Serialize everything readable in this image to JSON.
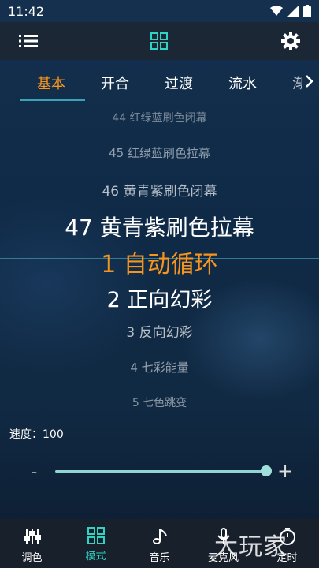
{
  "status": {
    "time": "11:42"
  },
  "tabs": [
    {
      "label": "基本",
      "active": true
    },
    {
      "label": "开合",
      "active": false
    },
    {
      "label": "过渡",
      "active": false
    },
    {
      "label": "流水",
      "active": false
    },
    {
      "label": "渐",
      "active": false
    }
  ],
  "wheel": [
    {
      "label": "44 红绿蓝刷色闭幕"
    },
    {
      "label": "45 红绿蓝刷色拉幕"
    },
    {
      "label": "46 黄青紫刷色闭幕"
    },
    {
      "label": "47 黄青紫刷色拉幕"
    },
    {
      "label": "1 自动循环",
      "selected": true
    },
    {
      "label": "2 正向幻彩"
    },
    {
      "label": "3 反向幻彩"
    },
    {
      "label": "4 七彩能量"
    },
    {
      "label": "5 七色跳变"
    }
  ],
  "speed": {
    "label": "速度：100",
    "value": 100,
    "minus": "-",
    "plus": "+"
  },
  "bottom_nav": [
    {
      "label": "调色",
      "icon": "sliders-icon"
    },
    {
      "label": "模式",
      "icon": "grid-icon",
      "active": true
    },
    {
      "label": "音乐",
      "icon": "music-note-icon"
    },
    {
      "label": "麦克风",
      "icon": "microphone-icon"
    },
    {
      "label": "定时",
      "icon": "timer-icon"
    }
  ],
  "watermark": "大玩家",
  "colors": {
    "accent": "#f7941d",
    "teal": "#2fd3c4"
  }
}
